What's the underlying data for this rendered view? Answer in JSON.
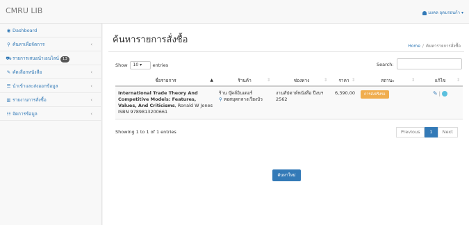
{
  "app": {
    "brand": "CMRU LIB",
    "user": "มงคล อุดมรอนก้า"
  },
  "sidebar": {
    "items": [
      {
        "icon": "dashboard-icon",
        "label": "Dashboard"
      },
      {
        "icon": "search-icon",
        "label": "ค้นหาเพื่อจัดการ"
      },
      {
        "icon": "cart-icon",
        "label": "รายการเสนอนำเอนไลน์",
        "badge": "13"
      },
      {
        "icon": "edit-icon",
        "label": "คัดเลือกหนังสือ"
      },
      {
        "icon": "list-icon",
        "label": "นำเข้าและส่งออกข้อมูล"
      },
      {
        "icon": "chart-icon",
        "label": "รายงานการสั่งซื้อ"
      },
      {
        "icon": "sliders-icon",
        "label": "จัดการข้อมูล"
      }
    ]
  },
  "page": {
    "title": "ค้นหารายการสั่งซื้อ",
    "breadcrumb": {
      "home": "Home",
      "separator": "/",
      "current": "ค้นหารายการสั่งซื้อ"
    }
  },
  "table_controls": {
    "show_label": "Show",
    "page_size": "10",
    "entries_label": "entries",
    "search_label": "Search:",
    "search_value": ""
  },
  "table": {
    "columns": [
      "ชื่อรายการ",
      "ร้านค้า",
      "ช่องทาง",
      "ราคา",
      "สถานะ",
      "แก้ไข"
    ],
    "row": {
      "title": "International Trade Theory And Competitive Models: Features, Values, And Criticisms",
      "author": ", Ronald W Jones",
      "isbn": "ISBN 9789813200661",
      "shop": "ร้าน บุ๊คส์อินเตอร์",
      "shop_location": "หอสมุดกลางเวียงบัว",
      "channel": "งานสัปดาห์หนังสือ ปีงบฯ 2562",
      "price": "6,390.00",
      "status": "การส่งจริงรอ"
    }
  },
  "footer": {
    "showing": "Showing 1 to 1 of 1 entries",
    "prev": "Previous",
    "page": "1",
    "next": "Next"
  },
  "actions": {
    "new_search": "ค้นหาใหม่"
  },
  "colors": {
    "primary": "#337ab7",
    "warning": "#f0ad4e",
    "info": "#5bc0de"
  }
}
